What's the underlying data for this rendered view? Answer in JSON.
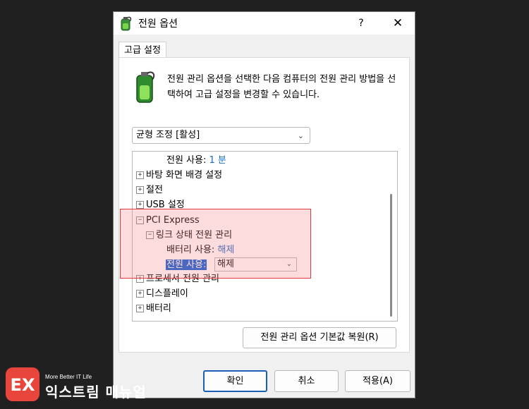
{
  "window": {
    "title": "전원 옵션",
    "help_label": "?",
    "close_label": "✕"
  },
  "tab": {
    "label": "고급 설정"
  },
  "description": "전원 관리 옵션을 선택한 다음 컴퓨터의 전원 관리 방법을 선택하여 고급 설정을 변경할 수 있습니다.",
  "plan_select": {
    "value": "균형 조정 [활성]"
  },
  "tree": {
    "rows": [
      {
        "label": "전원 사용: ",
        "value": "1 분"
      },
      {
        "label": "바탕 화면 배경 설정",
        "expander": "+"
      },
      {
        "label": "절전",
        "expander": "+"
      },
      {
        "label": "USB 설정",
        "expander": "+"
      },
      {
        "label": "PCI Express",
        "expander": "−"
      },
      {
        "label": "링크 상태 전원 관리",
        "expander": "−"
      },
      {
        "label": "배터리 사용: ",
        "value": "해제"
      },
      {
        "label": "전원 사용:",
        "value": "해제"
      },
      {
        "label": "프로세서 전원 관리",
        "expander": "+"
      },
      {
        "label": "디스플레이",
        "expander": "+"
      },
      {
        "label": "배터리",
        "expander": "+"
      }
    ]
  },
  "buttons": {
    "restore": "전원 관리 옵션 기본값 복원(R)",
    "ok": "확인",
    "cancel": "취소",
    "apply": "적용(A)"
  },
  "watermark": {
    "small": "More Better IT Life",
    "big": "익스트림 매뉴얼"
  },
  "colors": {
    "accent": "#0a5fd8",
    "value_text": "#1b6ac9",
    "highlight_border": "#e03a3a"
  }
}
